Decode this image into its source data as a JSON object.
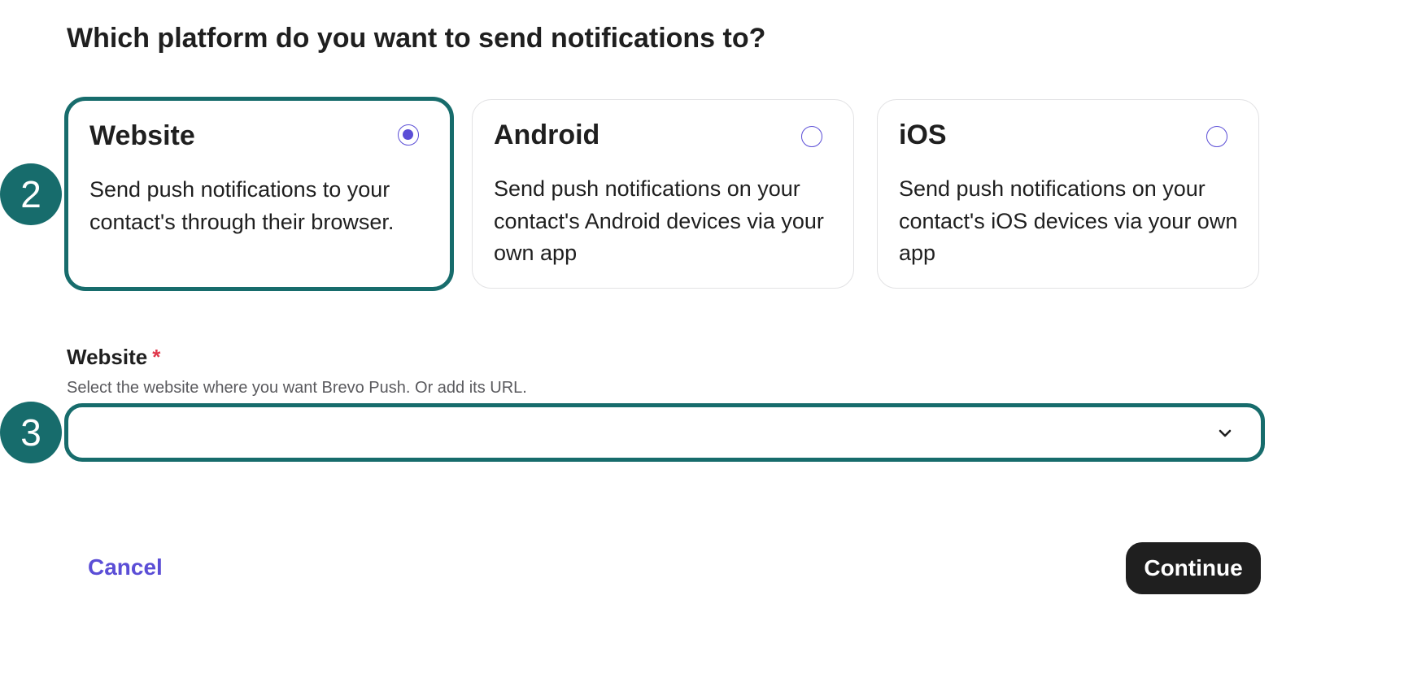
{
  "question": "Which platform do you want to send notifications to?",
  "platforms": [
    {
      "title": "Website",
      "description": "Send push notifications to your contact's through their browser.",
      "selected": true
    },
    {
      "title": "Android",
      "description": "Send push notifications on your contact's Android devices via your own app",
      "selected": false
    },
    {
      "title": "iOS",
      "description": "Send push notifications on your contact's iOS devices via your own app",
      "selected": false
    }
  ],
  "step_badges": [
    "2",
    "3"
  ],
  "website_field": {
    "label": "Website",
    "required_marker": "*",
    "help_text": "Select the website where you want Brevo Push. Or add its URL.",
    "value": ""
  },
  "actions": {
    "cancel_label": "Cancel",
    "continue_label": "Continue"
  },
  "colors": {
    "highlight": "#176c6c",
    "accent": "#5b4ed6",
    "required": "#e0384b",
    "primary_button": "#1f1f1f"
  }
}
